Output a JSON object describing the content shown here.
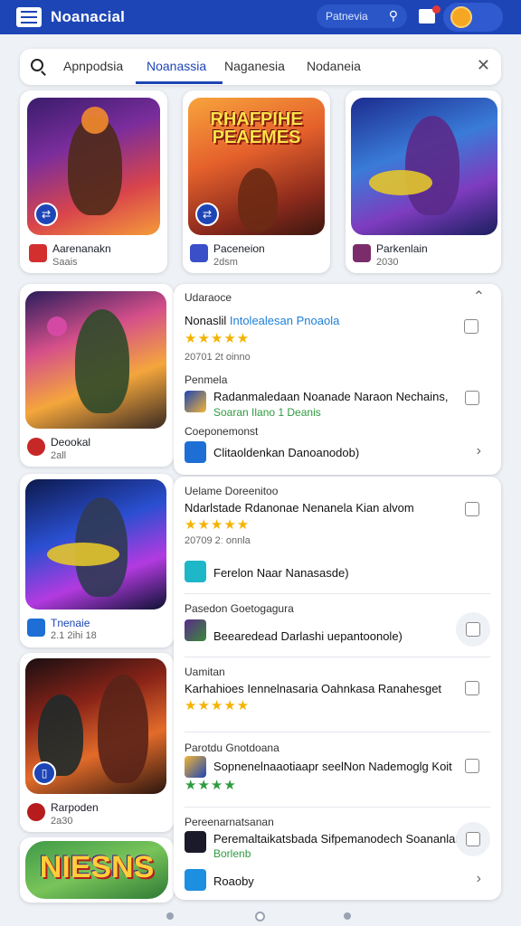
{
  "header": {
    "app_title": "Noanacial",
    "search_placeholder": "Patnevia",
    "menu_icon": "menu-icon",
    "colors": {
      "bar": "#1d45b6"
    }
  },
  "tabs": {
    "items": [
      "Apnpodsia",
      "Noanassia",
      "Naganesia",
      "Nodaneia"
    ],
    "active_index": 1
  },
  "top_tiles": [
    {
      "name": "Aarenanakn",
      "sub": "Saais",
      "icon_color": "#d32f2f"
    },
    {
      "name": "Paceneion",
      "sub": "2dsm",
      "icon_color": "#3b4fc9"
    },
    {
      "name": "Parkenlain",
      "sub": "2030",
      "icon_color": "#7b2d6b"
    }
  ],
  "tile_b_art_title": "RHAFPIHE PEAEMES",
  "left_tiles": [
    {
      "name": "Deookal",
      "sub": "2all",
      "icon_color": "#c62828"
    },
    {
      "name": "Tnenaie",
      "sub": "2.1 2ihi 18",
      "icon_color": "#1d6fd6"
    },
    {
      "name": "Rarpoden",
      "sub": "2a30",
      "icon_color": "#b71c1c"
    }
  ],
  "bottom_tile_art_title": "NIESNS",
  "panel1": {
    "header": "Udaraoce",
    "title_plain": "Nonaslil",
    "title_accent": "Intolealesan Pnoaola",
    "stars": "★★★★★",
    "meta": "20701 2t oinno",
    "section1": "Penmela",
    "row1_title": "Radanmaledaan Noanade Naraon Nechains,",
    "row1_sub": "Soaran Ilano 1 Deanis",
    "section2": "Coeponemonst",
    "row2_title": "Clitaoldenkan  Danoanodob)"
  },
  "panel2": {
    "header": "Uelame Doreenitoo",
    "title": "Ndarlstade Rdanonae Nenanela Kian alvom",
    "stars": "★★★★★",
    "meta": "20709 2ː onnla",
    "row1_title": "Ferelon  Naar Nanasasde)",
    "section1": "Pasedon Goetogagura",
    "row2_title": "Beearedead Darlashi uepantoonole)",
    "section2": "Uamitan",
    "row3_title": "Karhahioes Iennelnasaria Oahnkasa Ranahesget",
    "row3_stars": "★★★★★",
    "section3": "Parotdu Gnotdoana",
    "row4_title": "Sopnenelnaaotiaapr seelNon Nademoglg Koit",
    "row4_stars": "★★★★",
    "section4": "Pereenarnatsanan",
    "row5_title": "Peremaltaikatsbada Sifpemanodech Soananlan",
    "row5_sub": "Borlenb",
    "row6_title": "Roaoby"
  }
}
